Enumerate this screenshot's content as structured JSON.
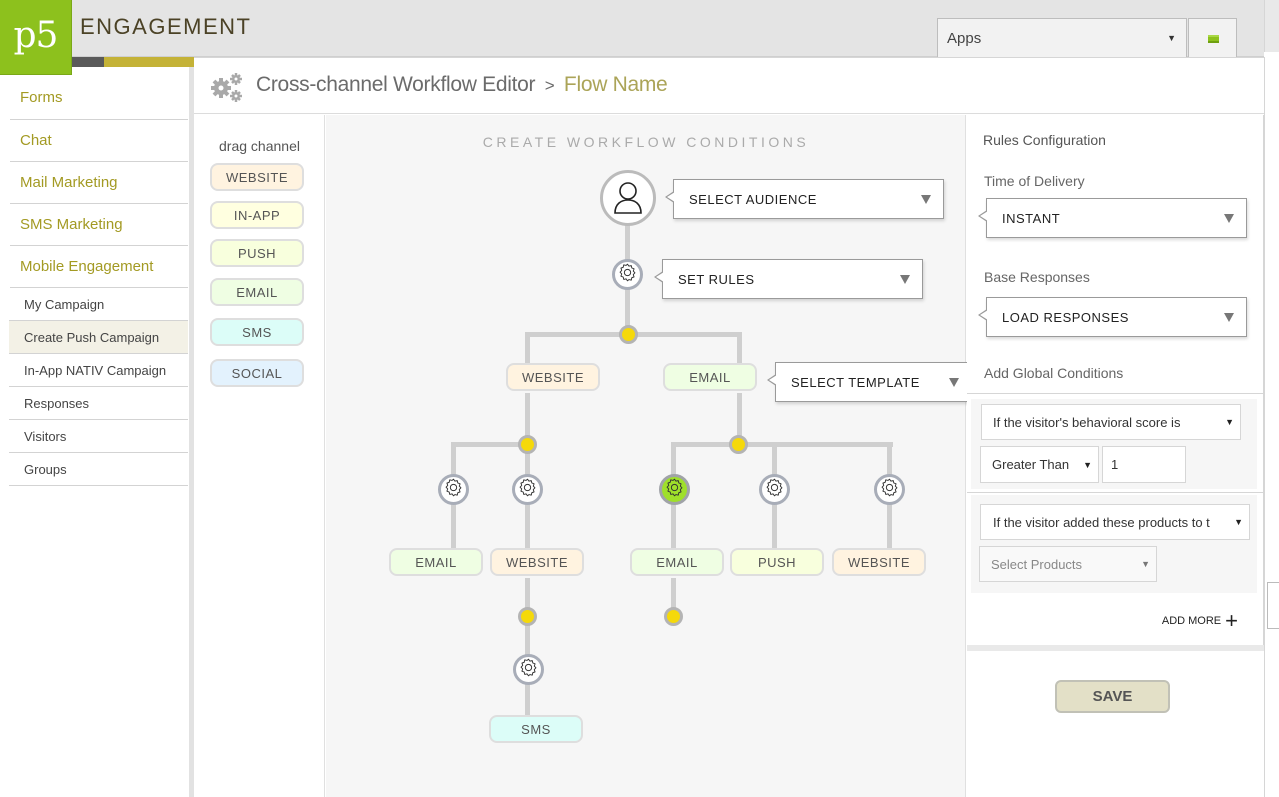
{
  "app": {
    "logo_text": "p5",
    "brand": "ENGAGEMENT",
    "colors": {
      "brand_green": "#8dc11d",
      "accent_gold": "#c4b237",
      "nav_text": "#a39a23",
      "node_yellow": "#f5d90a",
      "active_gear": "#9fe02a"
    }
  },
  "topbar": {
    "apps_select": {
      "value": "Apps",
      "icon": "caret-down-icon"
    },
    "menu_button": {
      "icon": "menu-icon"
    }
  },
  "sidebar": {
    "main_items": [
      {
        "label": "Forms"
      },
      {
        "label": "Chat"
      },
      {
        "label": "Mail Marketing"
      },
      {
        "label": "SMS Marketing"
      },
      {
        "label": "Mobile Engagement"
      }
    ],
    "sub_items": [
      {
        "label": "My Campaign",
        "active": false
      },
      {
        "label": "Create Push Campaign",
        "active": true
      },
      {
        "label": "In-App NATIV Campaign",
        "active": false
      },
      {
        "label": "Responses",
        "active": false
      },
      {
        "label": "Visitors",
        "active": false
      },
      {
        "label": "Groups",
        "active": false
      }
    ]
  },
  "header": {
    "icon": "gears-icon",
    "title": "Cross-channel Workflow Editor",
    "separator": ">",
    "flow_name": "Flow Name"
  },
  "palette": {
    "heading": "drag channel",
    "channels": [
      "WEBSITE",
      "IN-APP",
      "PUSH",
      "EMAIL",
      "SMS",
      "SOCIAL"
    ]
  },
  "canvas": {
    "heading": "CREATE WORKFLOW CONDITIONS",
    "audience_dropdown": "SELECT AUDIENCE",
    "rules_dropdown": "SET RULES",
    "template_dropdown": "SELECT TEMPLATE",
    "nodes": {
      "level1": [
        "WEBSITE",
        "EMAIL"
      ],
      "level2_left": [
        "EMAIL",
        "WEBSITE"
      ],
      "level2_right": [
        "EMAIL",
        "PUSH",
        "WEBSITE"
      ],
      "level3": [
        "SMS"
      ]
    }
  },
  "rules": {
    "title": "Rules Configuration",
    "time_of_delivery_label": "Time of Delivery",
    "time_of_delivery_value": "INSTANT",
    "base_responses_label": "Base Responses",
    "base_responses_value": "LOAD RESPONSES",
    "global_conditions_label": "Add Global Conditions",
    "condition1": {
      "type": "If the visitor's behavioral score is",
      "operator": "Greater Than",
      "value": "1"
    },
    "condition2": {
      "type": "If the visitor added these products to t",
      "products_placeholder": "Select Products"
    },
    "add_more_label": "ADD MORE",
    "add_more_icon": "+",
    "save_label": "SAVE"
  }
}
